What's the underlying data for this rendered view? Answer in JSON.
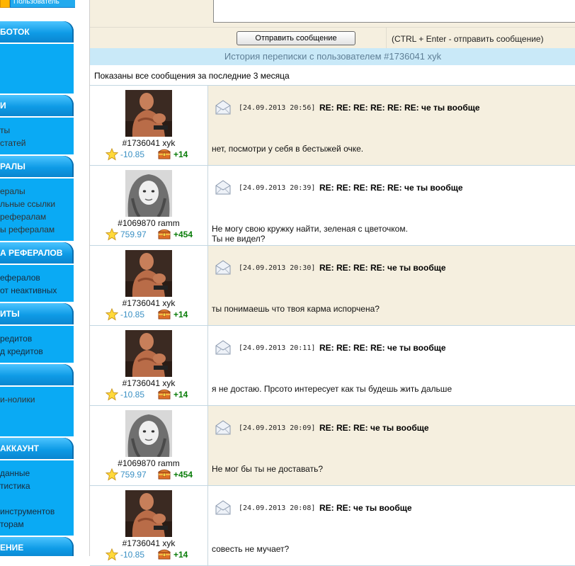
{
  "sidebar": {
    "top_tabs": [
      "",
      "Пользователь"
    ],
    "sections": [
      {
        "title": "БОТОК",
        "links": [
          "",
          ""
        ]
      },
      {
        "title": "И",
        "links": [
          "ты",
          "статей"
        ]
      },
      {
        "title": "РАЛЫ",
        "links": [
          "ералы",
          "льные ссылки",
          "рефералам",
          "ы рефералам"
        ]
      },
      {
        "title": "А РЕФЕРАЛОВ",
        "links": [
          "ефералов",
          "от неактивных"
        ]
      },
      {
        "title": "ИТЫ",
        "links": [
          "редитов",
          "д кредитов"
        ]
      },
      {
        "title": "",
        "links": [
          "и-нолики"
        ]
      },
      {
        "title": "АККАУНТ",
        "links": [
          "данные",
          "тистика",
          "инструментов",
          "торам"
        ]
      },
      {
        "title": "ЕНИЕ",
        "links": []
      }
    ]
  },
  "compose": {
    "send_label": "Отправить сообщение",
    "hint": "(CTRL + Enter - отправить сообщение)"
  },
  "history": {
    "header": "История переписки с пользователем #1736041 xyk",
    "note": "Показаны все сообщения за последние 3 месяца"
  },
  "messages": [
    {
      "user": "#1736041 xyk",
      "rating": "-10.85",
      "karma": "+14",
      "date": "[24.09.2013 20:56]",
      "subject": "RE: RE: RE: RE: RE: RE: че ты вообще",
      "body": "нет, посмотри у себя в бестыжей очке."
    },
    {
      "user": "#1069870 ramm",
      "rating": "759.97",
      "karma": "+454",
      "date": "[24.09.2013 20:39]",
      "subject": "RE: RE: RE: RE: RE: че ты вообще",
      "body": "Не могу свою кружку найти, зеленая с цветочком.\nТы не видел?"
    },
    {
      "user": "#1736041 xyk",
      "rating": "-10.85",
      "karma": "+14",
      "date": "[24.09.2013 20:30]",
      "subject": "RE: RE: RE: RE: че ты вообще",
      "body": "ты понимаешь что твоя карма испорчена?"
    },
    {
      "user": "#1736041 xyk",
      "rating": "-10.85",
      "karma": "+14",
      "date": "[24.09.2013 20:11]",
      "subject": "RE: RE: RE: RE: че ты вообще",
      "body": "я не достаю. Прсото интересует как ты будешь жить дальше"
    },
    {
      "user": "#1069870 ramm",
      "rating": "759.97",
      "karma": "+454",
      "date": "[24.09.2013 20:09]",
      "subject": "RE: RE: RE: че ты вообще",
      "body": "Не мог бы ты не доставать?"
    },
    {
      "user": "#1736041 xyk",
      "rating": "-10.85",
      "karma": "+14",
      "date": "[24.09.2013 20:08]",
      "subject": "RE: RE: че ты вообще",
      "body": "совесть не мучает?"
    }
  ]
}
